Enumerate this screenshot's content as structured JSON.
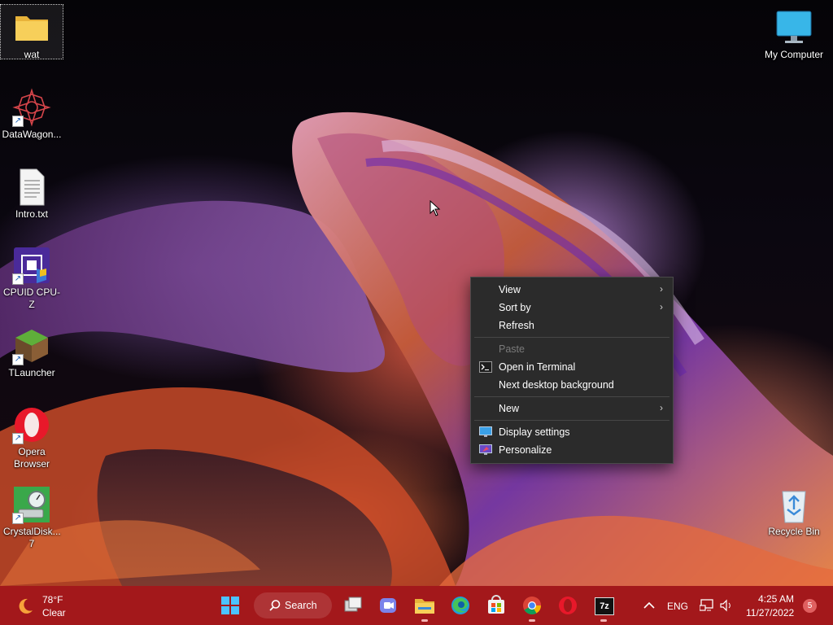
{
  "desktop_icons": [
    {
      "label": "wat",
      "icon": "folder-icon"
    },
    {
      "label": "DataWagon...",
      "icon": "datawagon-icon"
    },
    {
      "label": "Intro.txt",
      "icon": "text-file-icon"
    },
    {
      "label": "CPUID CPU-Z",
      "icon": "cpuz-icon"
    },
    {
      "label": "TLauncher",
      "icon": "tlauncher-icon"
    },
    {
      "label": "Opera Browser",
      "icon": "opera-icon"
    },
    {
      "label": "CrystalDisk... 7",
      "icon": "crystaldisk-icon"
    },
    {
      "label": "My Computer",
      "icon": "monitor-icon"
    },
    {
      "label": "Recycle Bin",
      "icon": "recycle-bin-icon"
    }
  ],
  "context_menu": {
    "items": [
      {
        "label": "View",
        "submenu": true,
        "enabled": true
      },
      {
        "label": "Sort by",
        "submenu": true,
        "enabled": true
      },
      {
        "label": "Refresh",
        "submenu": false,
        "enabled": true
      },
      {
        "label": "Paste",
        "submenu": false,
        "enabled": false
      },
      {
        "label": "Open in Terminal",
        "submenu": false,
        "enabled": true,
        "icon": "terminal-icon"
      },
      {
        "label": "Next desktop background",
        "submenu": false,
        "enabled": true
      },
      {
        "label": "New",
        "submenu": true,
        "enabled": true
      },
      {
        "label": "Display settings",
        "submenu": false,
        "enabled": true,
        "icon": "display-icon"
      },
      {
        "label": "Personalize",
        "submenu": false,
        "enabled": true,
        "icon": "personalize-icon"
      }
    ],
    "chevron": "›"
  },
  "taskbar": {
    "weather": {
      "temp": "78°F",
      "condition": "Clear"
    },
    "search_label": "Search",
    "apps": [
      "task-view-icon",
      "teams-chat-icon",
      "file-explorer-icon",
      "edge-icon",
      "store-icon",
      "chrome-icon",
      "opera-icon",
      "7zip-icon"
    ],
    "app_7zip_text": "7z",
    "tray": {
      "language": "ENG",
      "time": "4:25 AM",
      "date": "11/27/2022",
      "notification_count": "5"
    }
  },
  "colors": {
    "taskbar": "#a3181b",
    "menu_bg": "#2b2b2b"
  }
}
